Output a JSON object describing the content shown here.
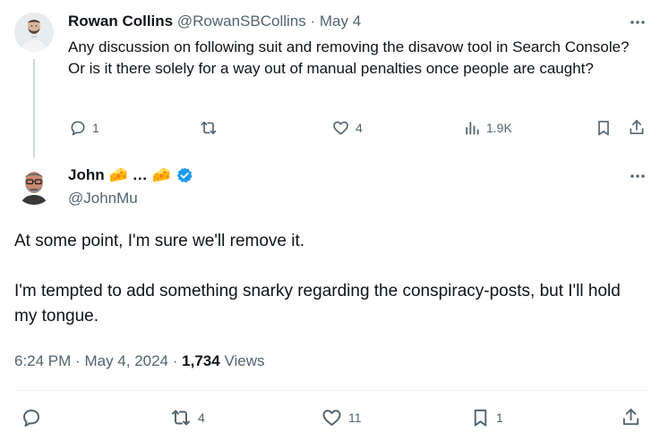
{
  "parent": {
    "name": "Rowan Collins",
    "handle": "@RowanSBCollins",
    "separator": "·",
    "date": "May 4",
    "text": "Any discussion on following suit and removing the disavow tool in Search Console? Or is it there solely for a way out of manual penalties once people are caught?",
    "actions": {
      "replies": "1",
      "reposts": "",
      "likes": "4",
      "views": "1.9K"
    }
  },
  "tweet": {
    "name": "John",
    "name_emoji_1": "🧀",
    "name_ellipsis": "…",
    "name_emoji_2": "🧀",
    "handle": "@JohnMu",
    "paragraphs": [
      "At some point, I'm sure we'll remove it.",
      "I'm tempted to add something snarky regarding the conspiracy-posts, but I'll hold my tongue."
    ],
    "time": "6:24 PM",
    "date": "May 4, 2024",
    "meta_separator": "·",
    "views_count": "1,734",
    "views_label": "Views",
    "actions": {
      "replies": "",
      "reposts": "4",
      "likes": "11",
      "bookmarks": "1"
    }
  },
  "icons": {
    "more": "more-horizontal-icon",
    "reply": "reply-bubble-icon",
    "repost": "repost-arrows-icon",
    "like": "heart-icon",
    "views": "analytics-bars-icon",
    "bookmark": "bookmark-icon",
    "share": "share-upload-icon",
    "verified": "verified-badge-icon"
  },
  "colors": {
    "text": "#0f1419",
    "muted": "#536471",
    "verified": "#1d9bf0",
    "thread_line": "#cfd9de",
    "divider": "#eff3f4"
  }
}
